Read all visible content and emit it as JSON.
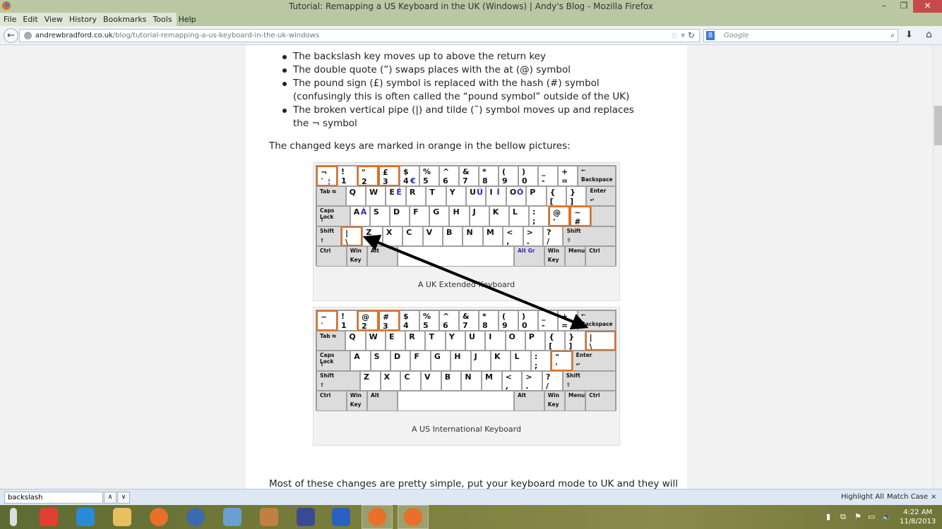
{
  "window": {
    "title": "Tutorial: Remapping a US Keyboard in the UK (Windows) | Andy's Blog - Mozilla Firefox",
    "minimize": "–",
    "restore": "❐",
    "close": "✕"
  },
  "menu": [
    "File",
    "Edit",
    "View",
    "History",
    "Bookmarks",
    "Tools",
    "Help"
  ],
  "nav": {
    "url_domain": "andrewbradford.co.uk",
    "url_path": "/blog/tutorial-remapping-a-us-keyboard-in-the-uk-windows",
    "search_placeholder": "Google",
    "search_engine_icon": "google-icon"
  },
  "article": {
    "bullets": [
      "The backslash key moves up to above the return key",
      "The double quote (”) swaps places with the at (@) symbol",
      "The pound sign (£) symbol is replaced with the hash (#) symbol (confusingly this is often called the “pound symbol” outside of the UK)",
      "The broken vertical pipe (|) and tilde (˜) symbol moves up and replaces the ¬ symbol"
    ],
    "intro": "The changed keys are marked in orange in the bellow pictures:",
    "outro": "Most of these changes are pretty simple, put your keyboard mode to UK and they will"
  },
  "highlight_color": "#e07020",
  "keyboards": [
    {
      "caption": "A UK Extended Keyboard",
      "rows": [
        [
          {
            "t": "¬",
            "b": "`",
            "a": "¦",
            "hl": true
          },
          {
            "t": "!",
            "b": "1"
          },
          {
            "t": "\"",
            "b": "2",
            "hl": true
          },
          {
            "t": "£",
            "b": "3",
            "hl": true
          },
          {
            "t": "$",
            "b": "4",
            "a": "€"
          },
          {
            "t": "%",
            "b": "5"
          },
          {
            "t": "^",
            "b": "6"
          },
          {
            "t": "&",
            "b": "7"
          },
          {
            "t": "*",
            "b": "8"
          },
          {
            "t": "(",
            "b": "9"
          },
          {
            "t": ")",
            "b": "0"
          },
          {
            "t": "_",
            "b": "-"
          },
          {
            "t": "+",
            "b": "="
          },
          {
            "t": "←",
            "b": "Backspace",
            "mod": true
          }
        ],
        [
          {
            "t": "Tab ⭾",
            "mod": true
          },
          {
            "t": "Q"
          },
          {
            "t": "W"
          },
          {
            "t": "E",
            "a": "É"
          },
          {
            "t": "R"
          },
          {
            "t": "T"
          },
          {
            "t": "Y"
          },
          {
            "t": "U",
            "a": "Ú"
          },
          {
            "t": "I",
            "a": "Í"
          },
          {
            "t": "O",
            "a": "Ó"
          },
          {
            "t": "P"
          },
          {
            "t": "{",
            "b": "["
          },
          {
            "t": "}",
            "b": "]"
          },
          {
            "t": "Enter",
            "b": "↵",
            "mod": true
          }
        ],
        [
          {
            "t": "Caps Lock",
            "b": "⇧",
            "mod": true
          },
          {
            "t": "A",
            "a": "Á"
          },
          {
            "t": "S"
          },
          {
            "t": "D"
          },
          {
            "t": "F"
          },
          {
            "t": "G"
          },
          {
            "t": "H"
          },
          {
            "t": "J"
          },
          {
            "t": "K"
          },
          {
            "t": "L"
          },
          {
            "t": ":",
            "b": ";"
          },
          {
            "t": "@",
            "b": "'",
            "hl": true
          },
          {
            "t": "~",
            "b": "#",
            "hl": true
          },
          {
            "t": "",
            "mod": true
          }
        ],
        [
          {
            "t": "Shift",
            "b": "⇧",
            "mod": true
          },
          {
            "t": "|",
            "b": "\\",
            "hl": true
          },
          {
            "t": "Z"
          },
          {
            "t": "X"
          },
          {
            "t": "C"
          },
          {
            "t": "V"
          },
          {
            "t": "B"
          },
          {
            "t": "N"
          },
          {
            "t": "M"
          },
          {
            "t": "<",
            "b": ","
          },
          {
            "t": ">",
            "b": "."
          },
          {
            "t": "?",
            "b": "/"
          },
          {
            "t": "Shift",
            "b": "⇧",
            "mod": true
          }
        ],
        [
          {
            "t": "Ctrl",
            "mod": true
          },
          {
            "t": "Win",
            "b": "Key",
            "mod": true
          },
          {
            "t": "Alt",
            "mod": true
          },
          {
            "t": ""
          },
          {
            "t": "Alt Gr",
            "mod": true,
            "blue": true
          },
          {
            "t": "Win",
            "b": "Key",
            "mod": true
          },
          {
            "t": "Menu",
            "mod": true
          },
          {
            "t": "Ctrl",
            "mod": true
          }
        ]
      ]
    },
    {
      "caption": "A US International Keyboard",
      "rows": [
        [
          {
            "t": "~",
            "b": "`",
            "hl": true
          },
          {
            "t": "!",
            "b": "1"
          },
          {
            "t": "@",
            "b": "2",
            "hl": true
          },
          {
            "t": "#",
            "b": "3",
            "hl": true
          },
          {
            "t": "$",
            "b": "4"
          },
          {
            "t": "%",
            "b": "5"
          },
          {
            "t": "^",
            "b": "6"
          },
          {
            "t": "&",
            "b": "7"
          },
          {
            "t": "*",
            "b": "8"
          },
          {
            "t": "(",
            "b": "9"
          },
          {
            "t": ")",
            "b": "0"
          },
          {
            "t": "_",
            "b": "-"
          },
          {
            "t": "+",
            "b": "="
          },
          {
            "t": "←",
            "b": "Backspace",
            "mod": true
          }
        ],
        [
          {
            "t": "Tab ⭾",
            "mod": true
          },
          {
            "t": "Q"
          },
          {
            "t": "W"
          },
          {
            "t": "E"
          },
          {
            "t": "R"
          },
          {
            "t": "T"
          },
          {
            "t": "Y"
          },
          {
            "t": "U"
          },
          {
            "t": "I"
          },
          {
            "t": "O"
          },
          {
            "t": "P"
          },
          {
            "t": "{",
            "b": "["
          },
          {
            "t": "}",
            "b": "]"
          },
          {
            "t": "|",
            "b": "\\",
            "hl": true
          }
        ],
        [
          {
            "t": "Caps Lock",
            "b": "⇧",
            "mod": true
          },
          {
            "t": "A"
          },
          {
            "t": "S"
          },
          {
            "t": "D"
          },
          {
            "t": "F"
          },
          {
            "t": "G"
          },
          {
            "t": "H"
          },
          {
            "t": "J"
          },
          {
            "t": "K"
          },
          {
            "t": "L"
          },
          {
            "t": ":",
            "b": ";"
          },
          {
            "t": "\"",
            "b": "'",
            "hl": true
          },
          {
            "t": "Enter",
            "b": "↵",
            "mod": true
          }
        ],
        [
          {
            "t": "Shift",
            "b": "⇧",
            "mod": true
          },
          {
            "t": "Z"
          },
          {
            "t": "X"
          },
          {
            "t": "C"
          },
          {
            "t": "V"
          },
          {
            "t": "B"
          },
          {
            "t": "N"
          },
          {
            "t": "M"
          },
          {
            "t": "<",
            "b": ","
          },
          {
            "t": ">",
            "b": "."
          },
          {
            "t": "?",
            "b": "/"
          },
          {
            "t": "Shift",
            "b": "⇧",
            "mod": true
          }
        ],
        [
          {
            "t": "Ctrl",
            "mod": true
          },
          {
            "t": "Win",
            "b": "Key",
            "mod": true
          },
          {
            "t": "Alt",
            "mod": true
          },
          {
            "t": ""
          },
          {
            "t": "Alt",
            "mod": true
          },
          {
            "t": "Win",
            "b": "Key",
            "mod": true
          },
          {
            "t": "Menu",
            "mod": true
          },
          {
            "t": "Ctrl",
            "mod": true
          }
        ]
      ]
    }
  ],
  "findbar": {
    "value": "backslash",
    "prev": "∧",
    "next": "∨",
    "highlight_all": "Highlight All",
    "match_case": "Match Case",
    "close": "×"
  },
  "taskbar": {
    "apps": [
      "desktop-icon",
      "shutdown-icon",
      "internet-explorer-icon",
      "file-explorer-icon",
      "firefox-icon",
      "thunderbird-icon",
      "control-panel-icon",
      "app-jar-icon",
      "app-icon",
      "start-screen-icon",
      "firefox-window-icon",
      "firefox-window-icon"
    ],
    "time": "4:22 AM",
    "date": "11/8/2013"
  }
}
